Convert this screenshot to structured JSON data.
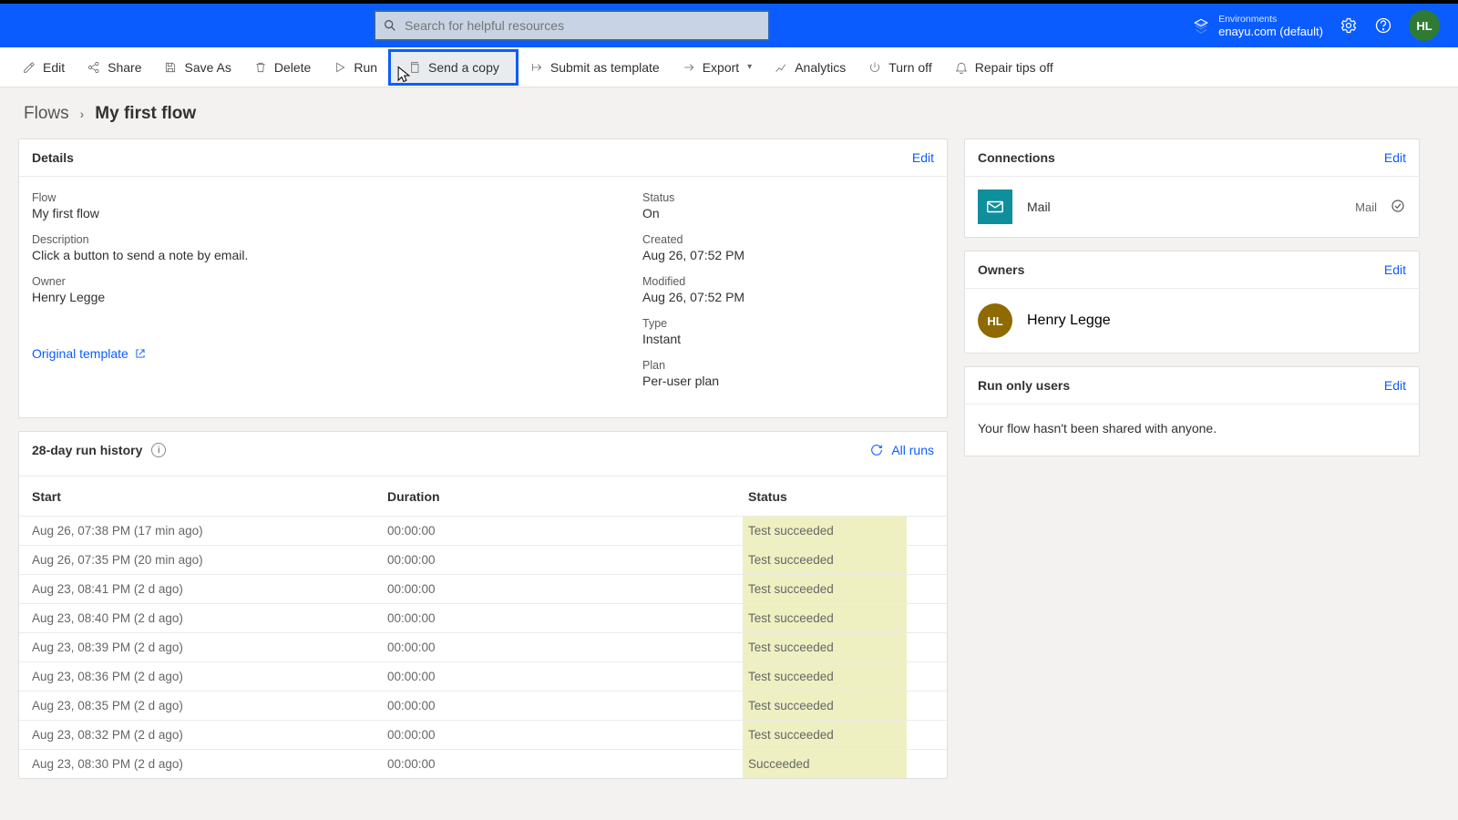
{
  "header": {
    "search_placeholder": "Search for helpful resources",
    "env_label": "Environments",
    "env_name": "enayu.com (default)",
    "avatar_initials": "HL"
  },
  "cmdbar": {
    "edit": "Edit",
    "share": "Share",
    "save_as": "Save As",
    "delete": "Delete",
    "run": "Run",
    "send_copy": "Send a copy",
    "submit_template": "Submit as template",
    "export": "Export",
    "analytics": "Analytics",
    "turn_off": "Turn off",
    "repair_tips_off": "Repair tips off"
  },
  "breadcrumbs": {
    "root": "Flows",
    "current": "My first flow"
  },
  "details": {
    "title": "Details",
    "edit": "Edit",
    "flow_label": "Flow",
    "flow_value": "My first flow",
    "description_label": "Description",
    "description_value": "Click a button to send a note by email.",
    "owner_label": "Owner",
    "owner_value": "Henry Legge",
    "status_label": "Status",
    "status_value": "On",
    "created_label": "Created",
    "created_value": "Aug 26, 07:52 PM",
    "modified_label": "Modified",
    "modified_value": "Aug 26, 07:52 PM",
    "type_label": "Type",
    "type_value": "Instant",
    "plan_label": "Plan",
    "plan_value": "Per-user plan",
    "original_template": "Original template"
  },
  "history": {
    "title": "28-day run history",
    "all_runs": "All runs",
    "col_start": "Start",
    "col_duration": "Duration",
    "col_status": "Status",
    "rows": [
      {
        "start": "Aug 26, 07:38 PM (17 min ago)",
        "duration": "00:00:00",
        "status": "Test succeeded"
      },
      {
        "start": "Aug 26, 07:35 PM (20 min ago)",
        "duration": "00:00:00",
        "status": "Test succeeded"
      },
      {
        "start": "Aug 23, 08:41 PM (2 d ago)",
        "duration": "00:00:00",
        "status": "Test succeeded"
      },
      {
        "start": "Aug 23, 08:40 PM (2 d ago)",
        "duration": "00:00:00",
        "status": "Test succeeded"
      },
      {
        "start": "Aug 23, 08:39 PM (2 d ago)",
        "duration": "00:00:00",
        "status": "Test succeeded"
      },
      {
        "start": "Aug 23, 08:36 PM (2 d ago)",
        "duration": "00:00:00",
        "status": "Test succeeded"
      },
      {
        "start": "Aug 23, 08:35 PM (2 d ago)",
        "duration": "00:00:00",
        "status": "Test succeeded"
      },
      {
        "start": "Aug 23, 08:32 PM (2 d ago)",
        "duration": "00:00:00",
        "status": "Test succeeded"
      },
      {
        "start": "Aug 23, 08:30 PM (2 d ago)",
        "duration": "00:00:00",
        "status": "Succeeded"
      }
    ]
  },
  "connections": {
    "title": "Connections",
    "edit": "Edit",
    "item_name": "Mail",
    "item_type": "Mail"
  },
  "owners": {
    "title": "Owners",
    "edit": "Edit",
    "initials": "HL",
    "name": "Henry Legge"
  },
  "run_only": {
    "title": "Run only users",
    "edit": "Edit",
    "body": "Your flow hasn't been shared with anyone."
  }
}
